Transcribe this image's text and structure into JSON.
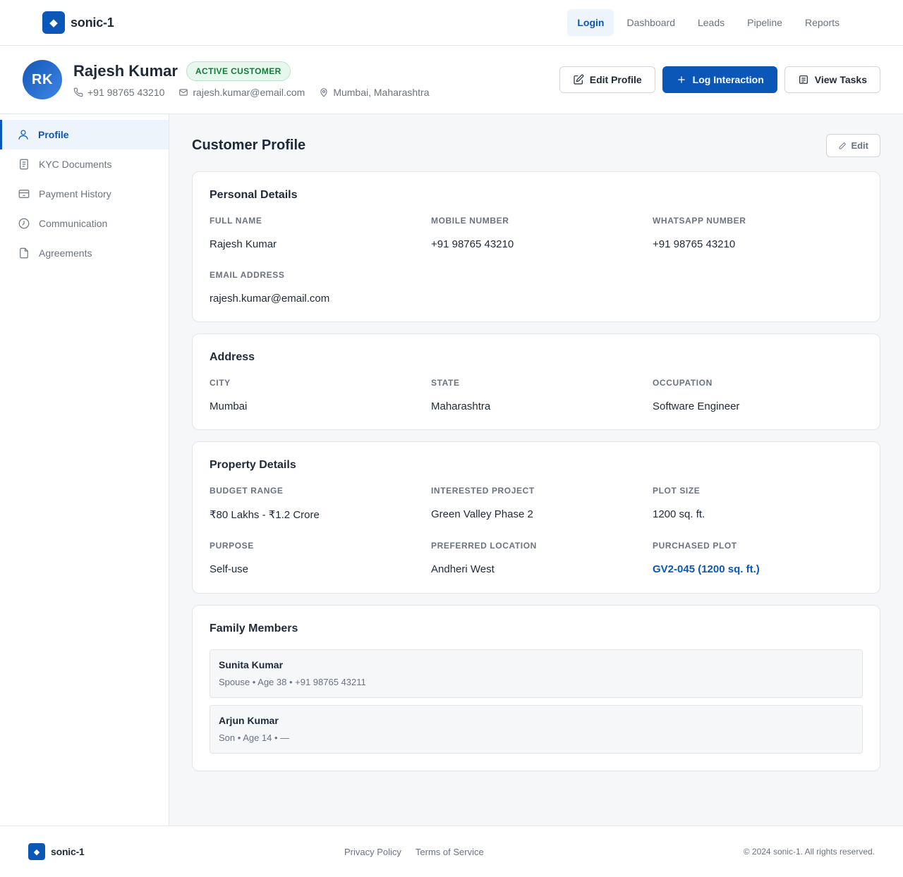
{
  "brand": {
    "name": "sonic-1",
    "logo_glyph": "◆"
  },
  "nav": {
    "items": [
      {
        "label": "Login",
        "active": true
      },
      {
        "label": "Dashboard",
        "active": false
      },
      {
        "label": "Leads",
        "active": false
      },
      {
        "label": "Pipeline",
        "active": false
      },
      {
        "label": "Reports",
        "active": false
      }
    ]
  },
  "customer": {
    "initials": "RK",
    "name": "Rajesh Kumar",
    "status": "ACTIVE CUSTOMER",
    "phone": "+91 98765 43210",
    "email": "rajesh.kumar@email.com",
    "location": "Mumbai, Maharashtra"
  },
  "actions": {
    "edit_profile": "Edit Profile",
    "log_interaction": "Log Interaction",
    "view_tasks": "View Tasks"
  },
  "sidebar": {
    "items": [
      {
        "label": "Profile",
        "icon": "user-icon",
        "active": true
      },
      {
        "label": "KYC Documents",
        "icon": "document-icon",
        "active": false
      },
      {
        "label": "Payment History",
        "icon": "payment-icon",
        "active": false
      },
      {
        "label": "Communication",
        "icon": "clock-icon",
        "active": false
      },
      {
        "label": "Agreements",
        "icon": "file-icon",
        "active": false
      }
    ]
  },
  "main": {
    "title": "Customer Profile",
    "edit_label": "Edit",
    "personal": {
      "title": "Personal Details",
      "full_name_label": "FULL NAME",
      "full_name": "Rajesh Kumar",
      "mobile_label": "MOBILE NUMBER",
      "mobile": "+91 98765 43210",
      "whatsapp_label": "WHATSAPP NUMBER",
      "whatsapp": "+91 98765 43210",
      "email_label": "EMAIL ADDRESS",
      "email": "rajesh.kumar@email.com"
    },
    "address": {
      "title": "Address",
      "city_label": "CITY",
      "city": "Mumbai",
      "state_label": "STATE",
      "state": "Maharashtra",
      "occupation_label": "OCCUPATION",
      "occupation": "Software Engineer"
    },
    "property": {
      "title": "Property Details",
      "budget_label": "BUDGET RANGE",
      "budget": "₹80 Lakhs - ₹1.2 Crore",
      "project_label": "INTERESTED PROJECT",
      "project": "Green Valley Phase 2",
      "plot_size_label": "PLOT SIZE",
      "plot_size": "1200 sq. ft.",
      "purpose_label": "PURPOSE",
      "purpose": "Self-use",
      "location_label": "PREFERRED LOCATION",
      "location": "Andheri West",
      "purchased_label": "PURCHASED PLOT",
      "purchased": "GV2-045 (1200 sq. ft.)"
    },
    "family": {
      "title": "Family Members",
      "members": [
        {
          "name": "Sunita Kumar",
          "meta": "Spouse • Age 38 • +91 98765 43211"
        },
        {
          "name": "Arjun Kumar",
          "meta": "Son • Age 14 • —"
        }
      ]
    }
  },
  "footer": {
    "brand": "sonic-1",
    "privacy": "Privacy Policy",
    "terms": "Terms of Service",
    "copyright": "© 2024 sonic-1. All rights reserved."
  },
  "colors": {
    "accent": "#0b57b8",
    "success": "#137a3a",
    "success_bg": "#e7f7ee"
  }
}
